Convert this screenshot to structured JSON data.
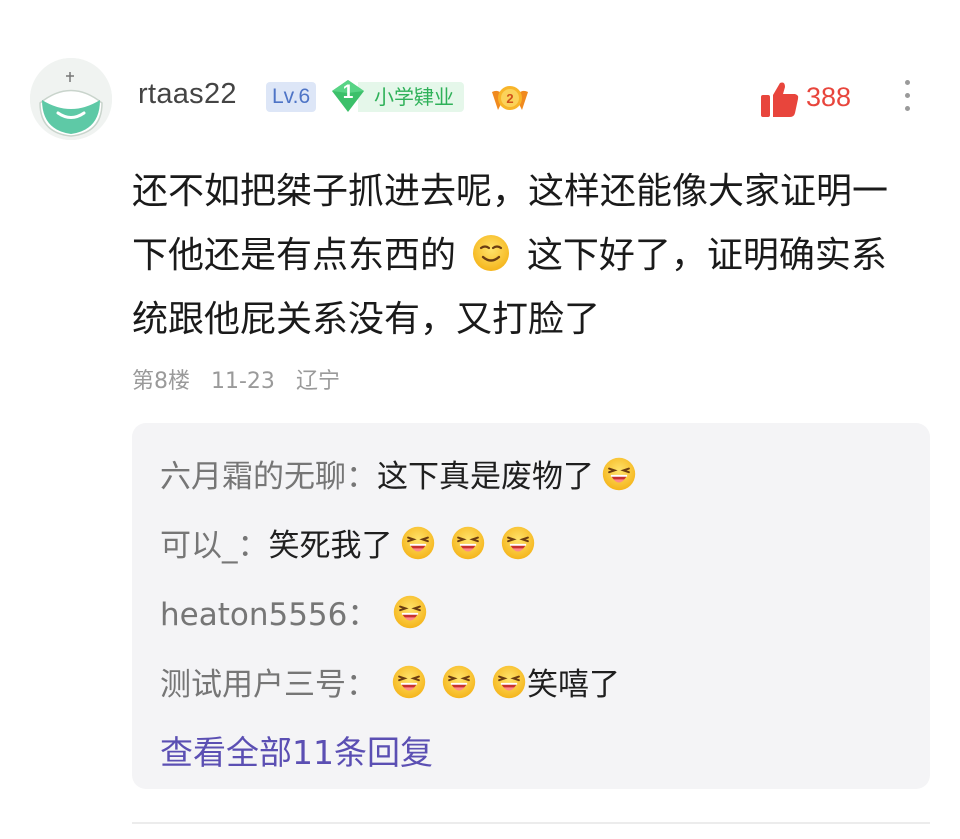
{
  "post": {
    "username": "rtaas22",
    "level": "Lv.6",
    "rank_number": "1",
    "rank_title": "小学肄业",
    "medal_number": "2",
    "like_count": "388",
    "content_part1": "还不如把桀子抓进去呢，这样还能像大家证明一下他还是有点东西的",
    "content_part2": "这下好了，证明确实系统跟他屁关系没有，又打脸了",
    "floor": "第8楼",
    "date": "11-23",
    "location": "辽宁"
  },
  "replies": [
    {
      "name": "六月霜的无聊：",
      "text": "这下真是废物了",
      "emoji_after": 1,
      "tail": ""
    },
    {
      "name": "可以_：",
      "text": "笑死我了",
      "emoji_after": 3,
      "tail": ""
    },
    {
      "name": "heaton5556：",
      "text": "",
      "emoji_after": 1,
      "tail": ""
    },
    {
      "name": "测试用户三号：",
      "text": "",
      "emoji_after": 3,
      "tail": "笑嘻了"
    }
  ],
  "view_all": "查看全部11条回复",
  "colors": {
    "like_red": "#e8453c",
    "level_blue": "#4e74c6",
    "rank_green": "#2fb159",
    "link_purple": "#5b4fb3"
  },
  "icons": {
    "avatar": "masked-face-avatar",
    "like": "thumbs-up-icon",
    "more": "more-vertical-icon",
    "medal": "medal-icon",
    "emoji_smile": "smile-emoji",
    "emoji_laugh": "laughing-emoji"
  }
}
